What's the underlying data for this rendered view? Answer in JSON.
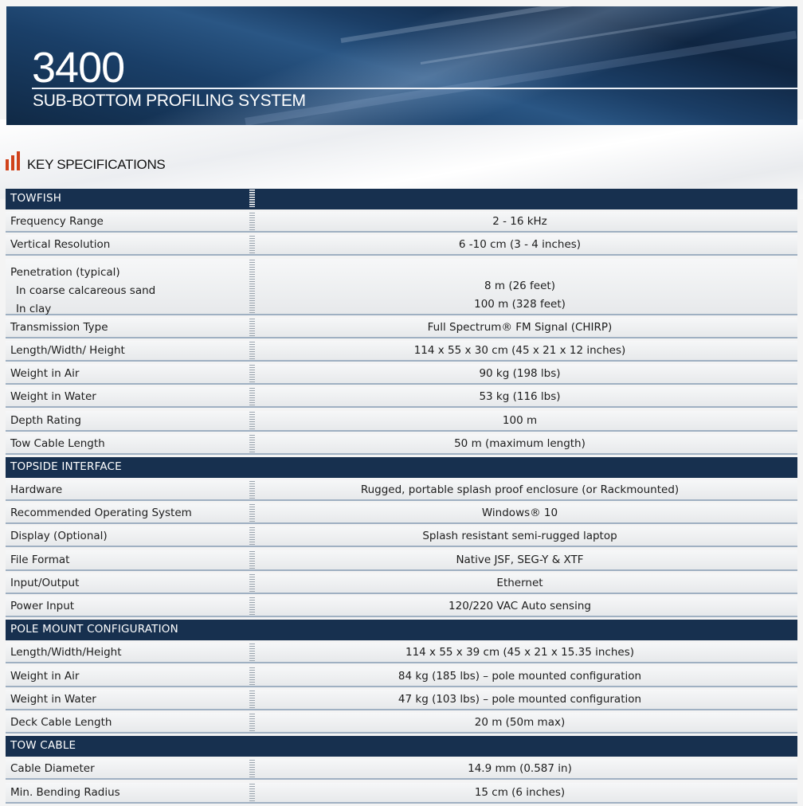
{
  "header": {
    "model": "3400",
    "subtitle": "SUB-BOTTOM PROFILING SYSTEM"
  },
  "section_heading": "KEY SPECIFICATIONS",
  "colors": {
    "banner": "#17304f",
    "section_bar": "#17304f",
    "accent_icon": "#d0421b"
  },
  "sections": {
    "towfish": {
      "title": "TOWFISH",
      "frequency_range": {
        "label": "Frequency Range",
        "value": "2 - 16 kHz"
      },
      "vertical_resolution": {
        "label": "Vertical Resolution",
        "value": "6 -10 cm (3 - 4 inches)"
      },
      "penetration": {
        "label": "Penetration (typical)",
        "sand_label": "In coarse calcareous sand",
        "sand_value": "8 m (26 feet)",
        "clay_label": "In clay",
        "clay_value": "100 m (328 feet)"
      },
      "transmission_type": {
        "label": "Transmission Type",
        "value": "Full Spectrum® FM Signal (CHIRP)"
      },
      "dimensions": {
        "label": "Length/Width/ Height",
        "value": "114 x 55 x 30 cm (45 x 21 x 12 inches)"
      },
      "weight_air": {
        "label": "Weight in Air",
        "value": "90 kg (198 lbs)"
      },
      "weight_water": {
        "label": "Weight in Water",
        "value": "53 kg (116 lbs)"
      },
      "depth_rating": {
        "label": "Depth Rating",
        "value": "100 m"
      },
      "tow_cable_length": {
        "label": "Tow Cable Length",
        "value": "50 m (maximum length)"
      }
    },
    "topside": {
      "title": "TOPSIDE INTERFACE",
      "hardware": {
        "label": "Hardware",
        "value": "Rugged, portable splash proof enclosure (or Rackmounted)"
      },
      "os": {
        "label": "Recommended Operating System",
        "value": "Windows® 10"
      },
      "display": {
        "label": "Display (Optional)",
        "value": "Splash resistant semi-rugged laptop"
      },
      "file_format": {
        "label": "File Format",
        "value": "Native JSF, SEG-Y & XTF"
      },
      "io": {
        "label": "Input/Output",
        "value": "Ethernet"
      },
      "power": {
        "label": "Power Input",
        "value": "120/220 VAC Auto sensing"
      }
    },
    "pole_mount": {
      "title": "POLE MOUNT CONFIGURATION",
      "dimensions": {
        "label": "Length/Width/Height",
        "value": "114 x 55 x 39 cm (45 x 21 x 15.35 inches)"
      },
      "weight_air": {
        "label": "Weight in Air",
        "value": "84 kg (185 lbs) – pole mounted configuration"
      },
      "weight_water": {
        "label": "Weight in Water",
        "value": "47 kg (103 lbs) – pole mounted configuration"
      },
      "deck_cable": {
        "label": "Deck Cable Length",
        "value": "20 m (50m max)"
      }
    },
    "tow_cable": {
      "title": "TOW CABLE",
      "diameter": {
        "label": "Cable Diameter",
        "value": "14.9 mm (0.587 in)"
      },
      "bending_radius": {
        "label": "Min. Bending Radius",
        "value": "15 cm (6 inches)"
      }
    }
  }
}
